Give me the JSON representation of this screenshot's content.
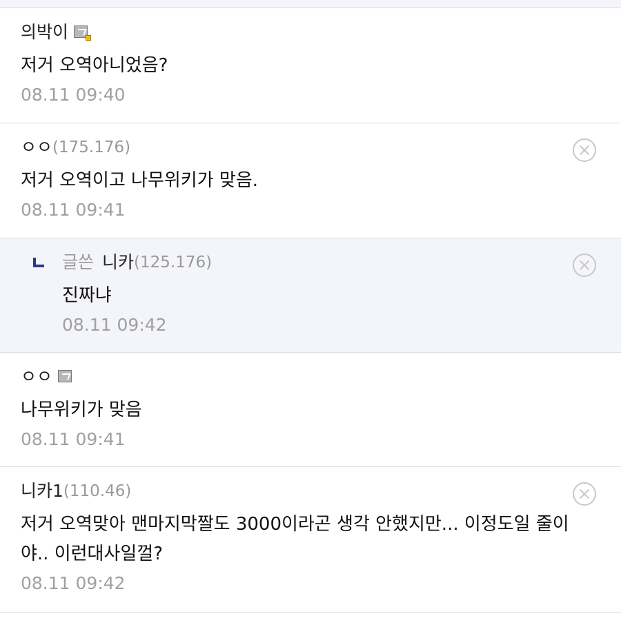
{
  "comments": [
    {
      "nick": "의박이",
      "ip": "",
      "body": "저거 오역아니었음?",
      "time": "08.11 09:40",
      "badge": "member-badge-gold",
      "deletable": false
    },
    {
      "nick": "ㅇㅇ",
      "ip": "(175.176)",
      "body": "저거 오역이고 나무위키가 맞음.",
      "time": "08.11 09:41",
      "deletable": true
    },
    {
      "author_label": "글쓴",
      "nick": "니카",
      "ip": "(125.176)",
      "body": "진짜냐",
      "time": "08.11 09:42",
      "is_reply": true,
      "deletable": true
    },
    {
      "nick": "ㅇㅇ",
      "ip": "",
      "body": "나무위키가 맞음",
      "time": "08.11 09:41",
      "badge": "member-badge",
      "deletable": false
    },
    {
      "nick": "니카1",
      "ip": "(110.46)",
      "body": "저거 오역맞아 맨마지막짤도 3000이라곤 생각 안했지만... 이정도일 줄이야.. 이런대사일껄?",
      "time": "08.11 09:42",
      "deletable": true
    }
  ]
}
